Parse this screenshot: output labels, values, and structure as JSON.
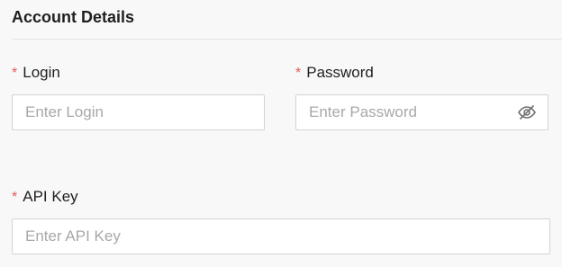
{
  "section": {
    "title": "Account Details"
  },
  "fields": {
    "login": {
      "required_mark": "*",
      "label": "Login",
      "value": "",
      "placeholder": "Enter Login"
    },
    "password": {
      "required_mark": "*",
      "label": "Password",
      "value": "",
      "placeholder": "Enter Password",
      "toggle_icon": "eye-off-icon"
    },
    "api_key": {
      "required_mark": "*",
      "label": "API Key",
      "value": "",
      "placeholder": "Enter API Key"
    }
  },
  "colors": {
    "background": "#f8f8f8",
    "required": "#e05a5a",
    "placeholder": "#a8a8a8",
    "border": "#d3d3d3"
  }
}
